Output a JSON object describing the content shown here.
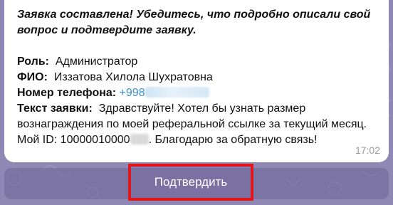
{
  "message": {
    "intro": "Заявка составлена! Убедитесь, что подробно описали свой вопрос и подтвердите заявку.",
    "role_label": "Роль:",
    "role_value": "Администратор",
    "name_label": "ФИО:",
    "name_value": "Иззатова Хилола Шухратовна",
    "phone_label": "Номер телефона:",
    "phone_value": "+998",
    "request_label": "Текст заявки:",
    "request_text_part1": "Здравствуйте! Хотел бы узнать размер вознаграждения по моей реферальной ссылке за текущий месяц. Мой ID: 10000010000",
    "request_text_part2": ". Благодарю за обратную связь!",
    "time": "17:02"
  },
  "keyboard": {
    "confirm_label": "Подтвердить"
  },
  "colors": {
    "chat_background": "#8f87b4",
    "link": "#3a8fd1",
    "highlight_border": "#e0161b"
  }
}
